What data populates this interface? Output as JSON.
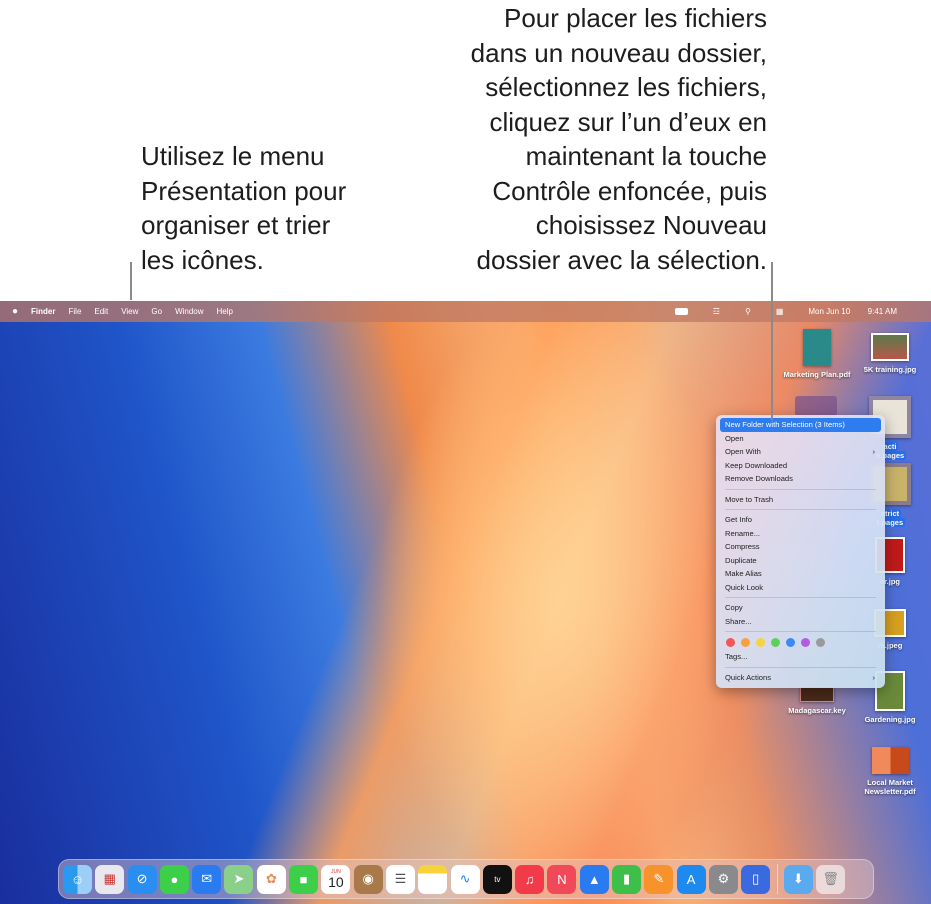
{
  "callouts": {
    "left": [
      "Utilisez le menu",
      "Présentation pour",
      "organiser et trier",
      "les icônes."
    ],
    "right": [
      "Pour placer les fichiers",
      "dans un nouveau dossier,",
      "sélectionnez les fichiers,",
      "cliquez sur l’un d’eux en",
      "maintenant la touche",
      "Contrôle enfoncée, puis",
      "choisissez Nouveau",
      "dossier avec la sélection."
    ]
  },
  "menubar": {
    "apple": "",
    "app": "Finder",
    "items": [
      "File",
      "Edit",
      "View",
      "Go",
      "Window",
      "Help"
    ],
    "date": "Mon Jun 10",
    "time": "9:41 AM"
  },
  "desktop": {
    "icons": [
      "Marketing Plan.pdf",
      "5K training.jpg",
      "acti",
      "n.pages",
      "strict",
      "t.pages",
      "er.jpg",
      "rs.jpeg",
      "Madagascar.key",
      "Gardening.jpg",
      "Local Market",
      "Newsletter.pdf"
    ]
  },
  "context_menu": {
    "items": [
      "New Folder with Selection (3 Items)",
      "Open",
      "Open With",
      "Keep Downloaded",
      "Remove Downloads",
      "Move to Trash",
      "Get Info",
      "Rename...",
      "Compress",
      "Duplicate",
      "Make Alias",
      "Quick Look",
      "Copy",
      "Share...",
      "Tags...",
      "Quick Actions"
    ],
    "tag_colors": [
      "#f25656",
      "#f7a13d",
      "#f5d443",
      "#5dcf5d",
      "#3d8af7",
      "#b35ce0",
      "#9a9a9a"
    ]
  },
  "dock": {
    "calendar_month": "JUN",
    "calendar_day": "10",
    "tv": "tv",
    "apps": [
      "finder",
      "launchpad",
      "safari",
      "messages",
      "mail",
      "maps",
      "photos",
      "facetime",
      "calendar",
      "contacts",
      "reminders",
      "notes",
      "freeform",
      "tv",
      "music",
      "news",
      "keynote",
      "numbers",
      "pages",
      "app-store",
      "system-settings",
      "iphone-mirroring",
      "downloads",
      "trash"
    ]
  }
}
